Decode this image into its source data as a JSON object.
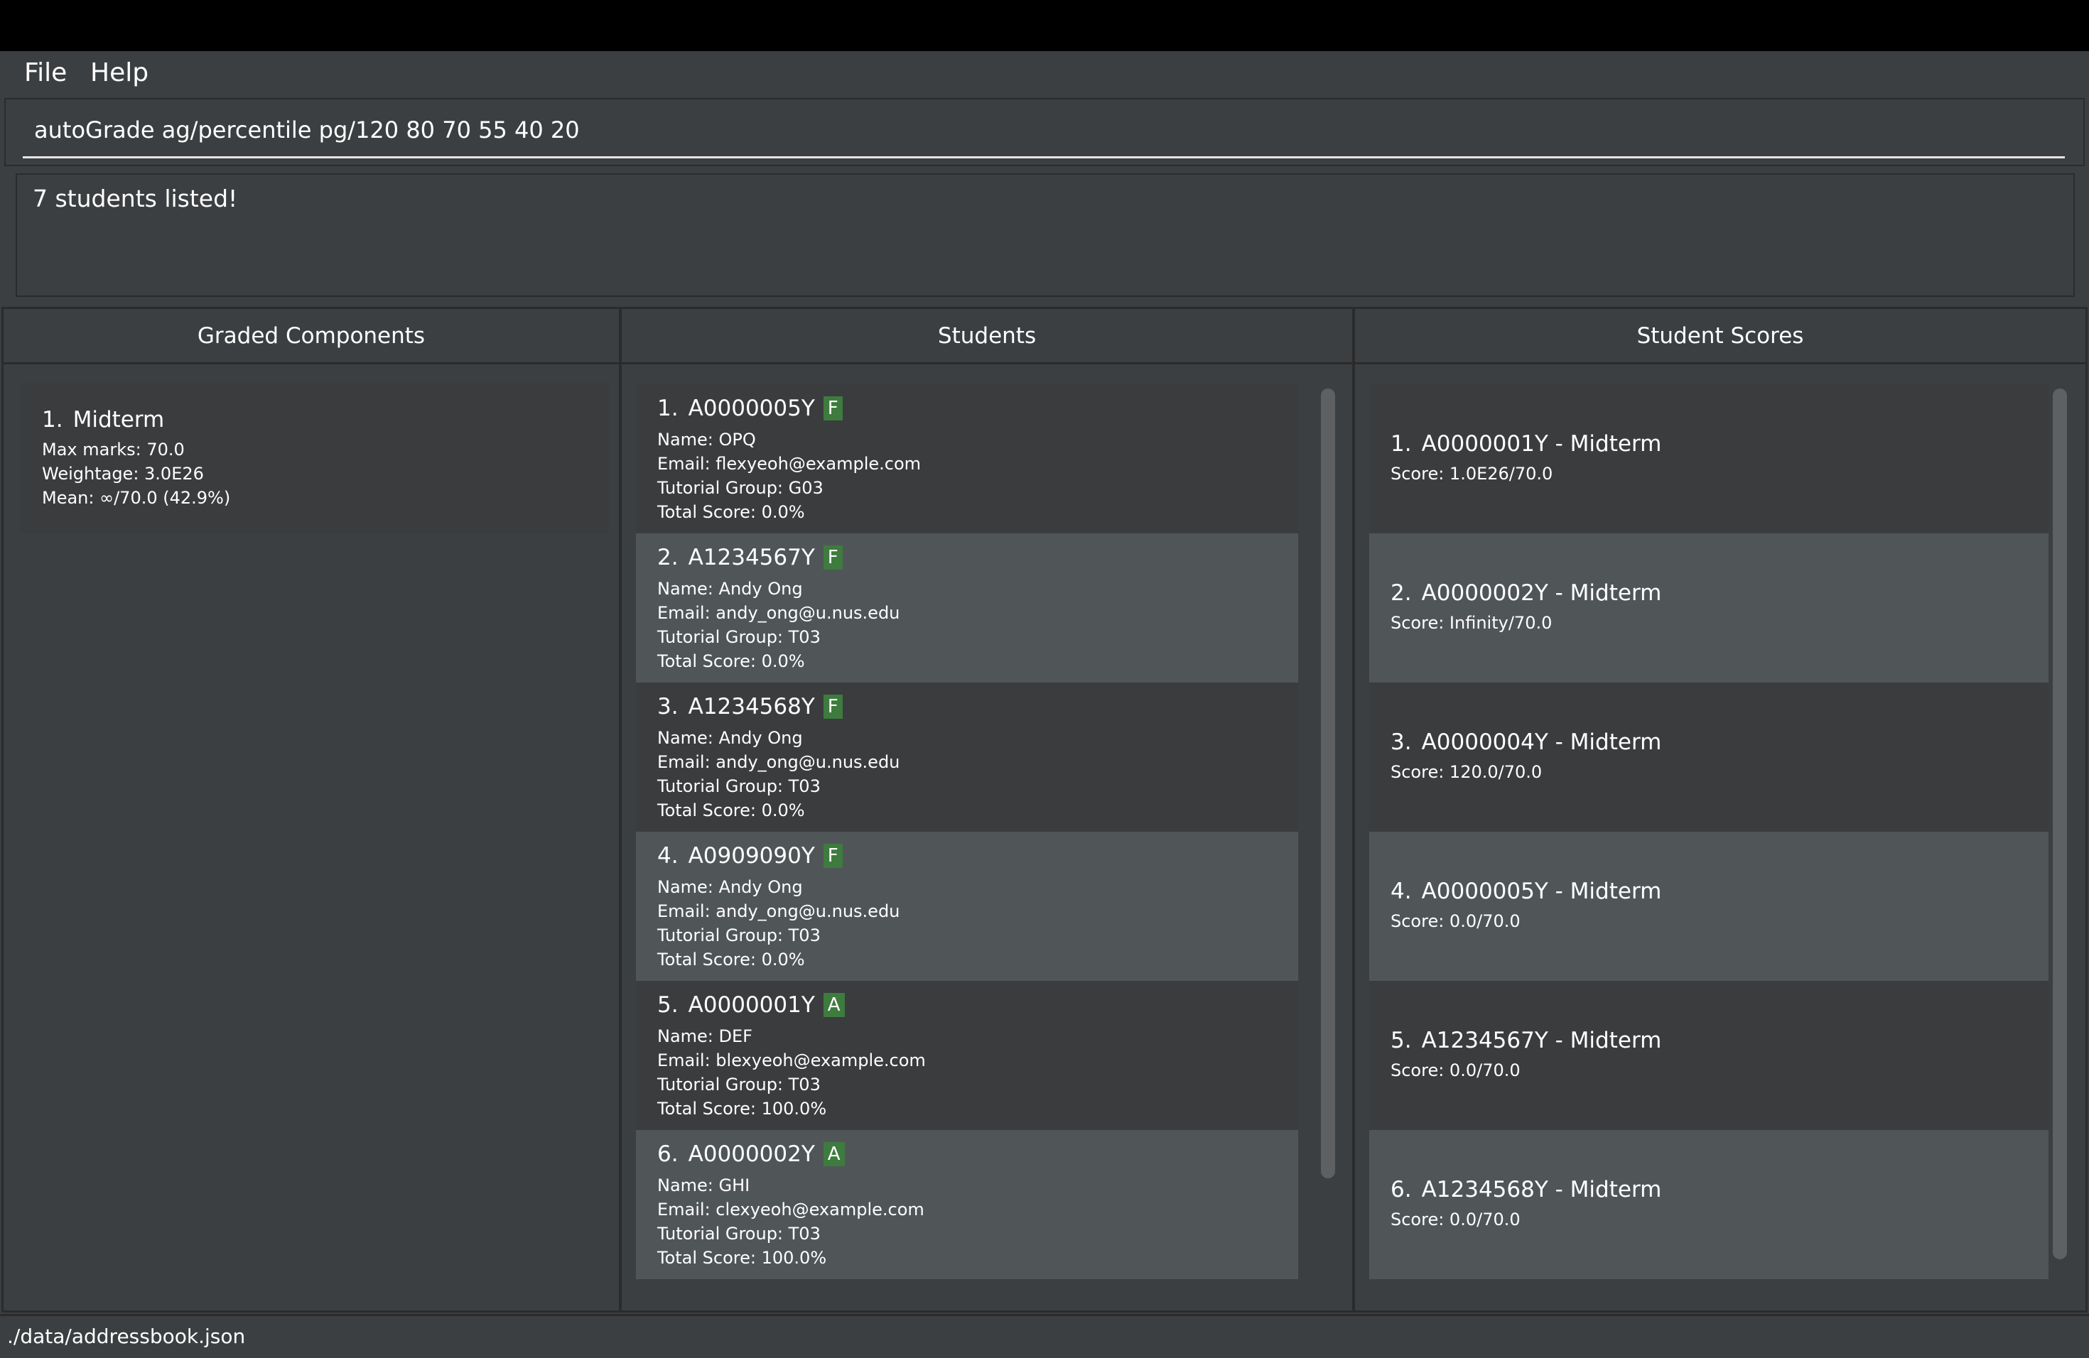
{
  "menu": {
    "file": "File",
    "help": "Help"
  },
  "command": {
    "value": "autoGrade ag/percentile pg/120 80 70 55 40 20"
  },
  "result": {
    "text": "7 students listed!"
  },
  "panels": {
    "components_title": "Graded Components",
    "students_title": "Students",
    "scores_title": "Student Scores"
  },
  "components": [
    {
      "index": "1.",
      "name": "Midterm",
      "max": "Max marks: 70.0",
      "weightage": "Weightage: 3.0E26",
      "mean": "Mean: ∞/70.0 (42.9%)"
    }
  ],
  "students": [
    {
      "index": "1.",
      "id": "A0000005Y",
      "grade": "F",
      "name": "Name: OPQ",
      "email": "Email: flexyeoh@example.com",
      "tutorial": "Tutorial Group: G03",
      "total": "Total Score: 0.0%"
    },
    {
      "index": "2.",
      "id": "A1234567Y",
      "grade": "F",
      "name": "Name: Andy Ong",
      "email": "Email: andy_ong@u.nus.edu",
      "tutorial": "Tutorial Group: T03",
      "total": "Total Score: 0.0%"
    },
    {
      "index": "3.",
      "id": "A1234568Y",
      "grade": "F",
      "name": "Name: Andy Ong",
      "email": "Email: andy_ong@u.nus.edu",
      "tutorial": "Tutorial Group: T03",
      "total": "Total Score: 0.0%"
    },
    {
      "index": "4.",
      "id": "A0909090Y",
      "grade": "F",
      "name": "Name: Andy Ong",
      "email": "Email: andy_ong@u.nus.edu",
      "tutorial": "Tutorial Group: T03",
      "total": "Total Score: 0.0%"
    },
    {
      "index": "5.",
      "id": "A0000001Y",
      "grade": "A",
      "name": "Name: DEF",
      "email": "Email: blexyeoh@example.com",
      "tutorial": "Tutorial Group: T03",
      "total": "Total Score: 100.0%"
    },
    {
      "index": "6.",
      "id": "A0000002Y",
      "grade": "A",
      "name": "Name: GHI",
      "email": "Email: clexyeoh@example.com",
      "tutorial": "Tutorial Group: T03",
      "total": "Total Score: 100.0%"
    }
  ],
  "scores": [
    {
      "index": "1.",
      "title": "A0000001Y - Midterm",
      "score": "Score: 1.0E26/70.0"
    },
    {
      "index": "2.",
      "title": "A0000002Y - Midterm",
      "score": "Score: Infinity/70.0"
    },
    {
      "index": "3.",
      "title": "A0000004Y - Midterm",
      "score": "Score: 120.0/70.0"
    },
    {
      "index": "4.",
      "title": "A0000005Y - Midterm",
      "score": "Score: 0.0/70.0"
    },
    {
      "index": "5.",
      "title": "A1234567Y - Midterm",
      "score": "Score: 0.0/70.0"
    },
    {
      "index": "6.",
      "title": "A1234568Y - Midterm",
      "score": "Score: 0.0/70.0"
    }
  ],
  "status": {
    "path": "./data/addressbook.json"
  },
  "colors": {
    "background": "#3c3f41",
    "card_dark": "#3a3c3e",
    "card_light": "#505658",
    "grade_badge": "#3e7b3e",
    "titlebar": "#000000"
  }
}
